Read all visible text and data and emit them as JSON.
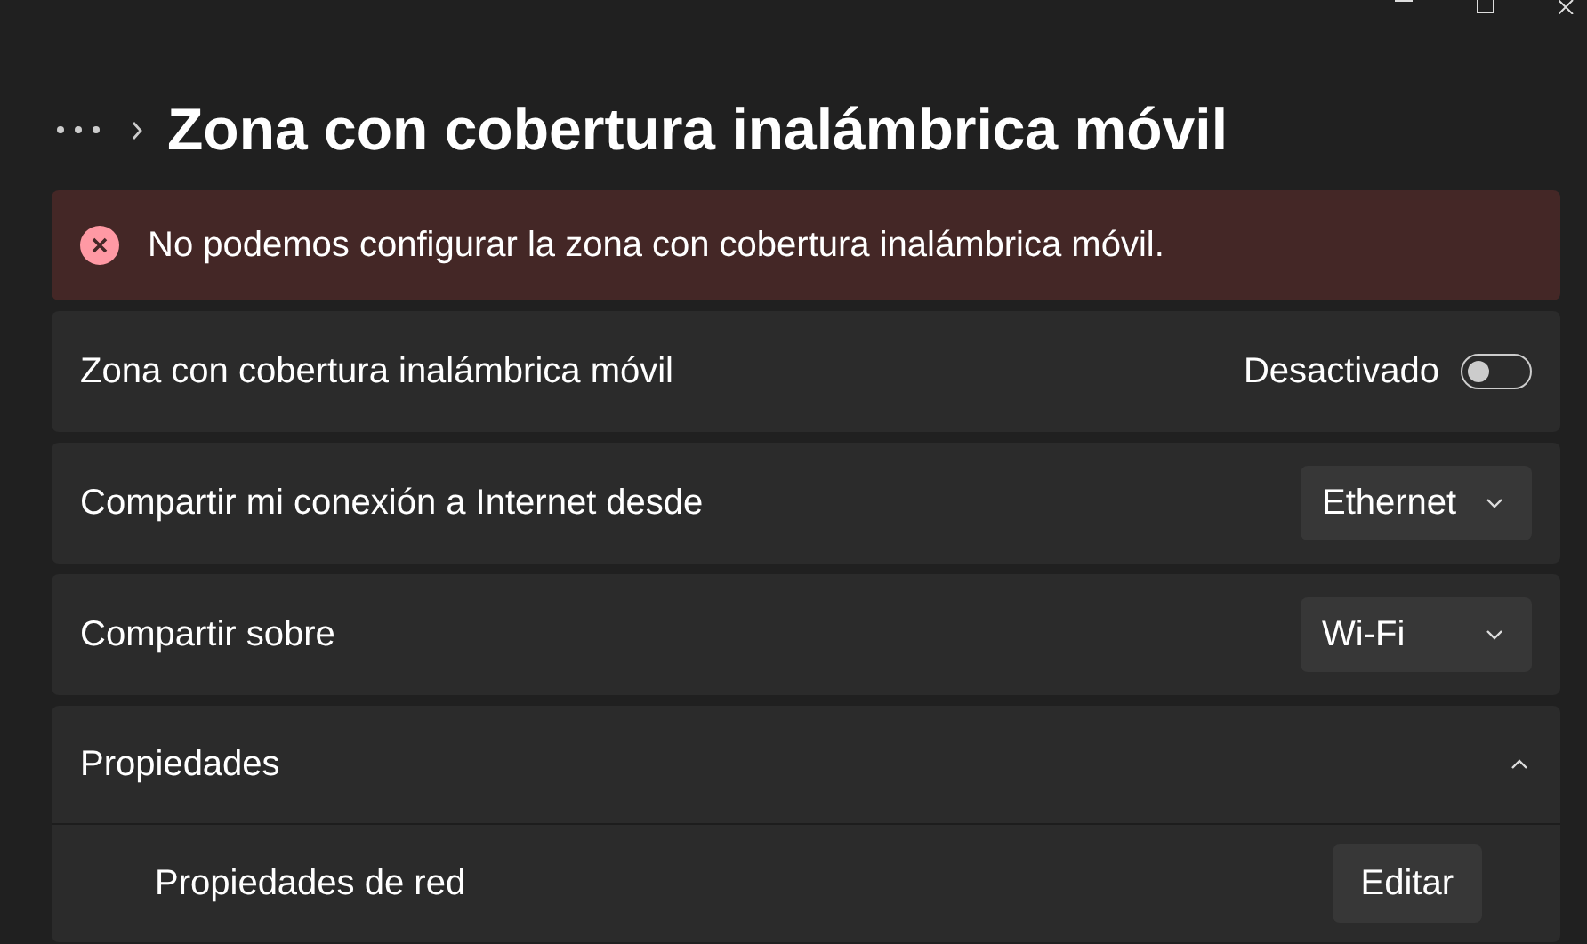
{
  "header": {
    "title": "Zona con cobertura inalámbrica móvil"
  },
  "error_banner": {
    "message": "No podemos configurar la zona con cobertura inalámbrica móvil."
  },
  "settings": [
    {
      "kind": "toggle",
      "label": "Zona con cobertura inalámbrica móvil",
      "state_text": "Desactivado",
      "on": false
    },
    {
      "kind": "dropdown",
      "label": "Compartir mi conexión a Internet desde",
      "value": "Ethernet"
    },
    {
      "kind": "dropdown",
      "label": "Compartir sobre",
      "value": "Wi-Fi"
    }
  ],
  "properties": {
    "label": "Propiedades",
    "expanded": true,
    "rows": [
      {
        "label": "Propiedades de red",
        "button": "Editar"
      }
    ]
  }
}
